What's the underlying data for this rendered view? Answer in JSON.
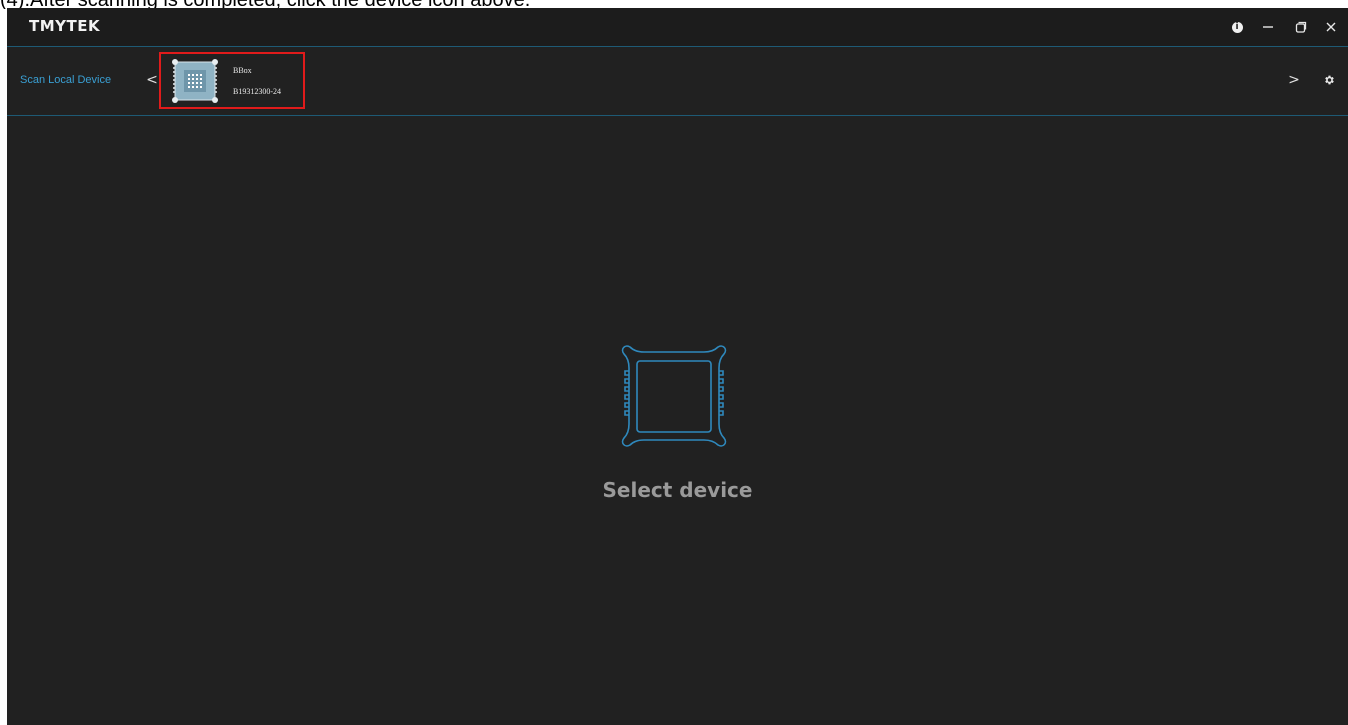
{
  "caption": "(4).After scanning is completed, click the device icon above.",
  "app": {
    "logo": "TMYTEK"
  },
  "toolbar": {
    "scan_label": "Scan Local Device",
    "prev_label": "<",
    "next_label": ">"
  },
  "device": {
    "name": "BBox",
    "serial": "B19312300-24"
  },
  "main": {
    "empty_label": "Select device"
  },
  "colors": {
    "accent": "#3a9fd3",
    "highlight": "#e01b1b",
    "background": "#212121"
  }
}
